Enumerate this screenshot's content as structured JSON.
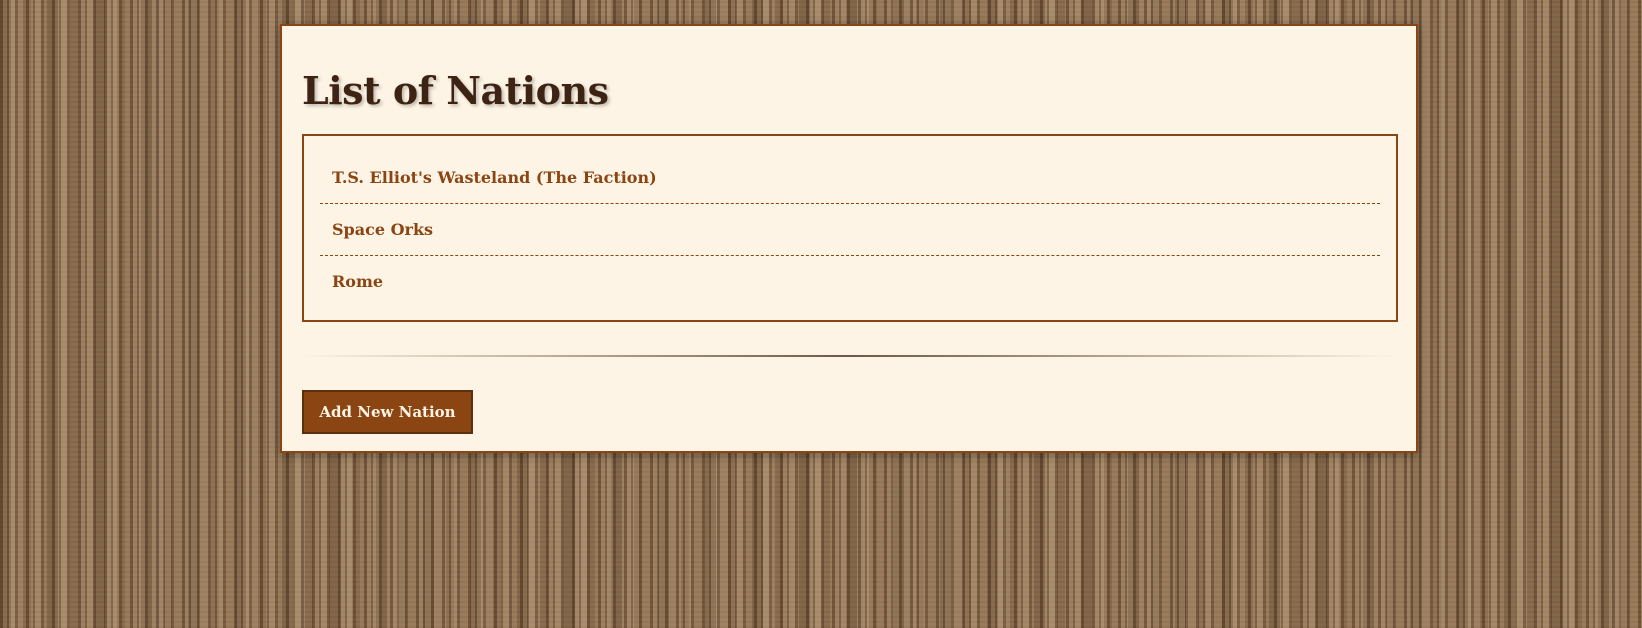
{
  "page": {
    "title": "List of Nations"
  },
  "nations": [
    {
      "name": "T.S. Elliot's Wasteland (The Faction)"
    },
    {
      "name": "Space Orks"
    },
    {
      "name": "Rome"
    }
  ],
  "actions": {
    "add_label": "Add New Nation"
  },
  "colors": {
    "accent": "#8b4513",
    "card_background": "#fdf4e5",
    "title_text": "#3d2314",
    "button_text": "#fdf4e5"
  }
}
